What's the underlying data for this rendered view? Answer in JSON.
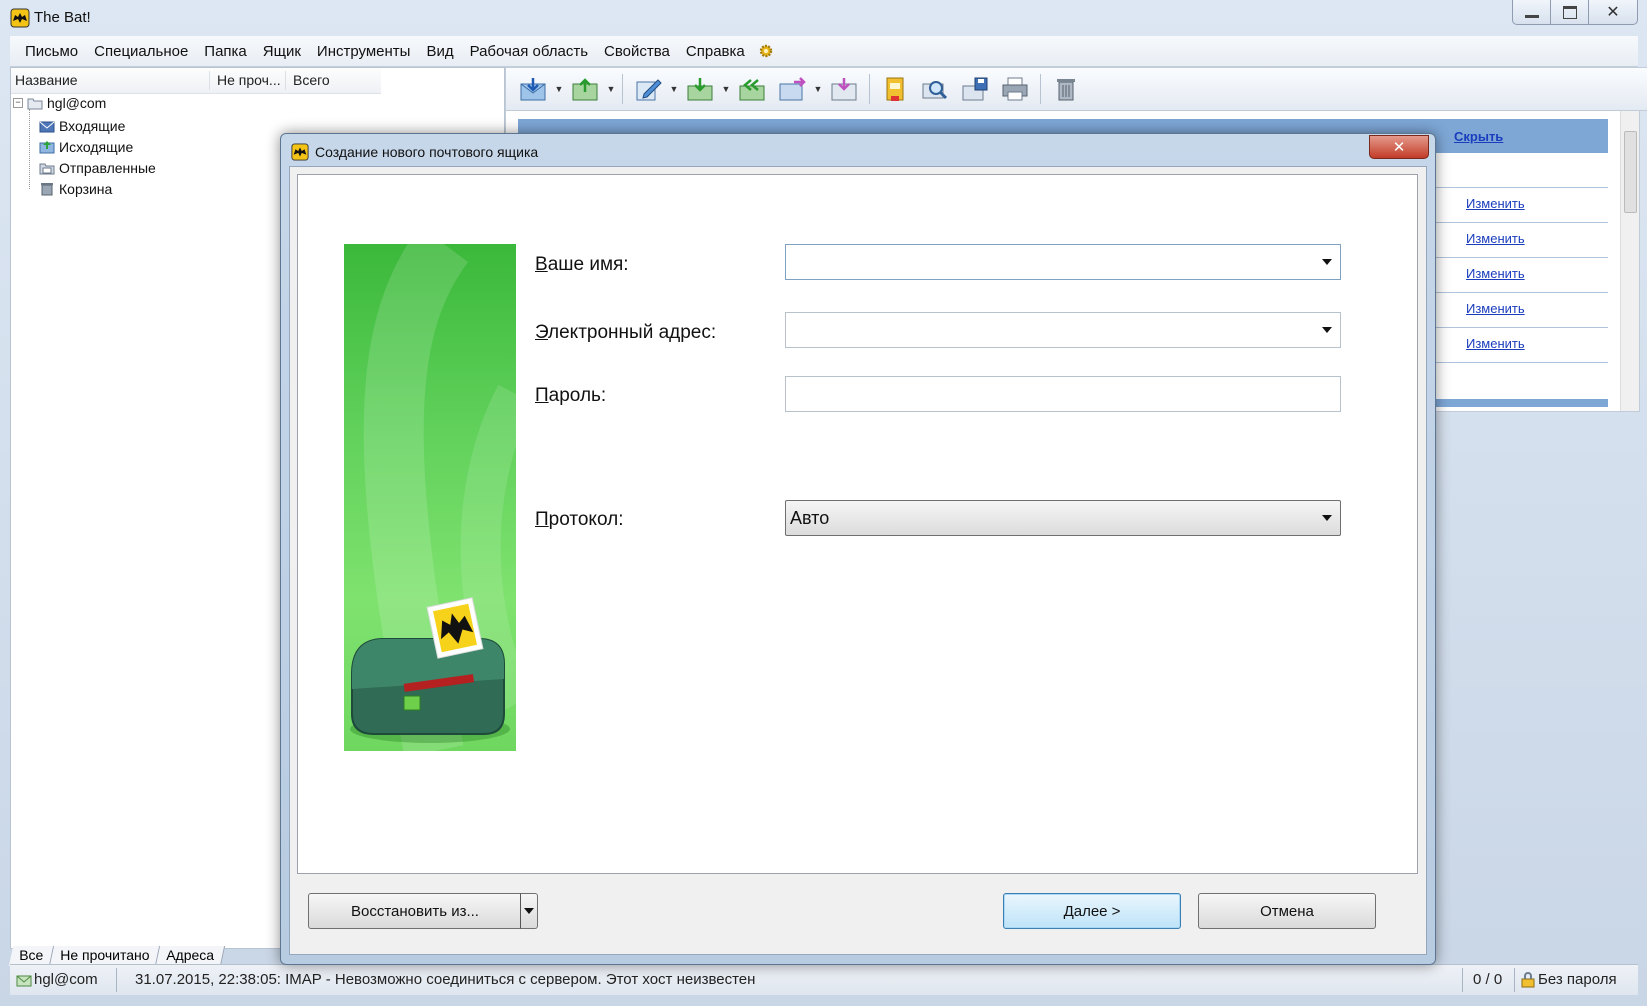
{
  "window": {
    "title": "The Bat!"
  },
  "menu": [
    "Письмо",
    "Специальное",
    "Папка",
    "Ящик",
    "Инструменты",
    "Вид",
    "Рабочая область",
    "Свойства",
    "Справка"
  ],
  "folder_panel": {
    "columns": [
      "Название",
      "Не проч...",
      "Всего"
    ],
    "account": "hgl@com",
    "folders": [
      "Входящие",
      "Исходящие",
      "Отправленные",
      "Корзина"
    ],
    "tabs": [
      "Все",
      "Не прочитано",
      "Адреса"
    ]
  },
  "message_area": {
    "hide_link": "Скрыть",
    "change_links": [
      "Изменить",
      "Изменить",
      "Изменить",
      "Изменить",
      "Изменить"
    ]
  },
  "statusbar": {
    "account": "hgl@com",
    "message": "31.07.2015, 22:38:05: IMAP  - Невозможно соединиться с сервером. Этот хост неизвестен",
    "count": "0 / 0",
    "security": "Без пароля"
  },
  "dialog": {
    "title": "Создание нового почтового ящика",
    "close_symbol": "✕",
    "fields": {
      "name_label_first": "В",
      "name_label_rest": "аше имя:",
      "email_label_first": "Э",
      "email_label_rest": "лектронный адрес:",
      "password_label_first": "П",
      "password_label_rest": "ароль:",
      "protocol_label_first": "П",
      "protocol_label_rest": "ротокол:",
      "name_value": "",
      "email_value": "",
      "password_value": "",
      "protocol_value": "Авто"
    },
    "buttons": {
      "restore": "Восстановить из...",
      "next": "Далее  >",
      "cancel": "Отмена"
    }
  },
  "colors": {
    "accent_blue": "#7ea7d6",
    "link": "#1a3dbd",
    "banner_green": "#4fc84a"
  }
}
